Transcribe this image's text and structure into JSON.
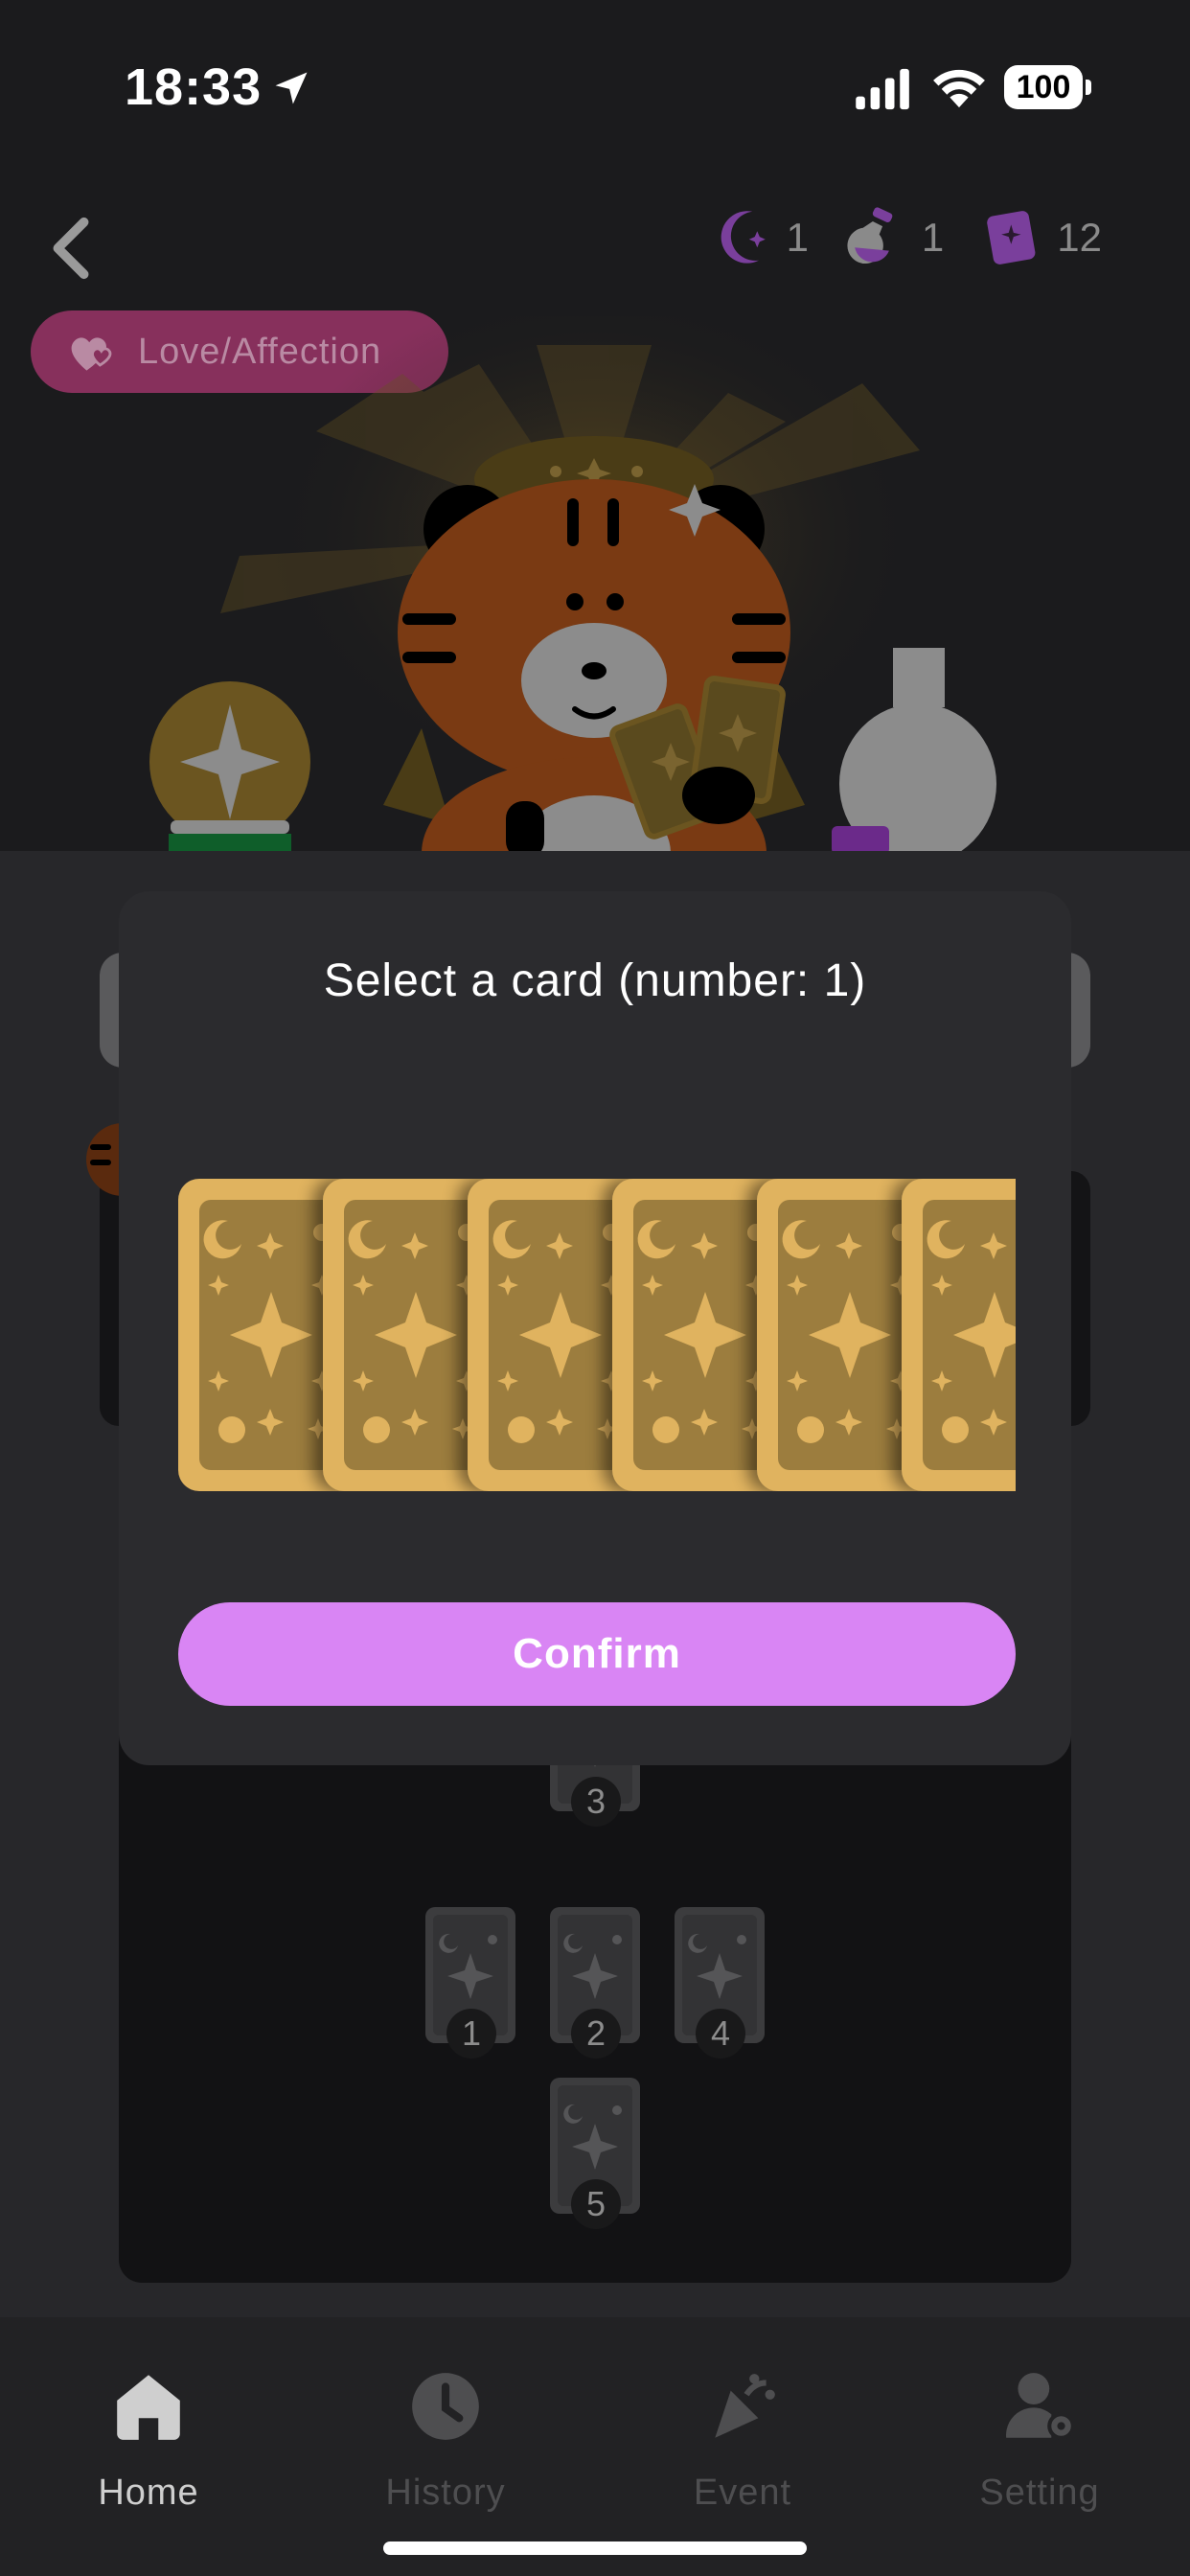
{
  "status_bar": {
    "time": "18:33",
    "battery": "100"
  },
  "header": {
    "resources": [
      {
        "icon": "moon-icon",
        "count": "1"
      },
      {
        "icon": "potion-icon",
        "count": "1"
      },
      {
        "icon": "spellbook-icon",
        "count": "12"
      }
    ],
    "topic": "Love/Affection"
  },
  "modal": {
    "title": "Select a card (number: 1)",
    "confirm_label": "Confirm",
    "card_count": 6
  },
  "spread": {
    "slots": [
      "3",
      "1",
      "2",
      "4",
      "5"
    ]
  },
  "tabs": [
    {
      "label": "Home",
      "icon": "home-icon",
      "active": true
    },
    {
      "label": "History",
      "icon": "clock-icon",
      "active": false
    },
    {
      "label": "Event",
      "icon": "party-popper-icon",
      "active": false
    },
    {
      "label": "Setting",
      "icon": "user-gear-icon",
      "active": false
    }
  ],
  "colors": {
    "accent": "#d985f4",
    "topic_pill": "#87305c",
    "card_gold": "#e0b35f",
    "tab_active": "#cfcfcf",
    "tab_inactive": "#4e4e50"
  }
}
